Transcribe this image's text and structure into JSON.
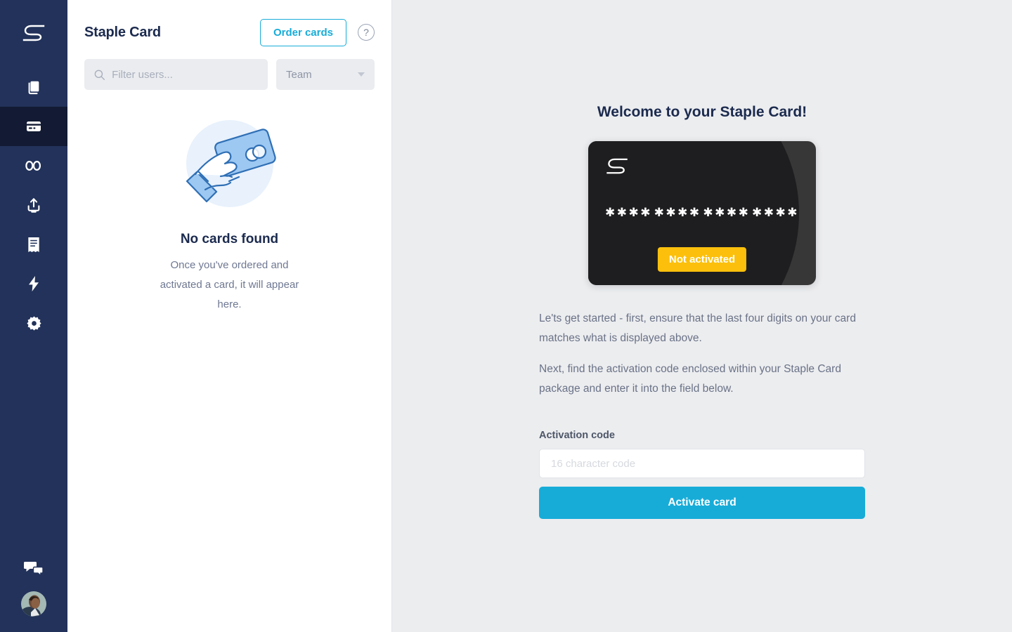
{
  "sidebar": {
    "brand_icon": "staple-s-logo",
    "items": [
      {
        "id": "documents",
        "icon": "documents-icon",
        "active": false
      },
      {
        "id": "cards",
        "icon": "credit-card-icon",
        "active": true
      },
      {
        "id": "links",
        "icon": "infinity-link-icon",
        "active": false
      },
      {
        "id": "upload",
        "icon": "upload-icon",
        "active": false
      },
      {
        "id": "receipts",
        "icon": "receipt-icon",
        "active": false
      },
      {
        "id": "activity",
        "icon": "lightning-bolt-icon",
        "active": false
      },
      {
        "id": "settings",
        "icon": "gear-icon",
        "active": false
      }
    ],
    "chat_icon": "chat-bubbles-icon",
    "avatar_label": "user-avatar"
  },
  "left_panel": {
    "title": "Staple Card",
    "order_cards_label": "Order cards",
    "help_label": "?",
    "search": {
      "value": "",
      "placeholder": "Filter users..."
    },
    "team_select": {
      "label": "Team"
    },
    "empty_state": {
      "illustration": "hand-holding-card-illustration",
      "title": "No cards found",
      "subtitle": "Once you've ordered and activated a card, it will appear here."
    }
  },
  "right_panel": {
    "welcome_title": "Welcome to your Staple Card!",
    "card": {
      "logo_icon": "staple-s-logo",
      "digit_groups": [
        "✱✱✱✱",
        "✱✱✱✱",
        "✱✱✱✱",
        "✱✱✱✱"
      ],
      "status_badge": "Not activated",
      "badge_color": "#fcc00c",
      "base_color": "#373737",
      "blob_color": "#1e1e20"
    },
    "paragraph_1": "Le'ts get started - first, ensure that the last four digits on your card matches what is displayed above.",
    "paragraph_2": "Next, find the activation code enclosed within your Staple Card package and enter it into the field below.",
    "activation_code_label": "Activation code",
    "activation_code_input": {
      "value": "",
      "placeholder": "16 character code"
    },
    "activate_button_label": "Activate card"
  },
  "theme": {
    "sidebar_bg": "#22325a",
    "sidebar_active_bg": "#121b33",
    "accent": "#17acd8",
    "right_bg": "#ecedef",
    "heading": "#1b2a4e"
  }
}
